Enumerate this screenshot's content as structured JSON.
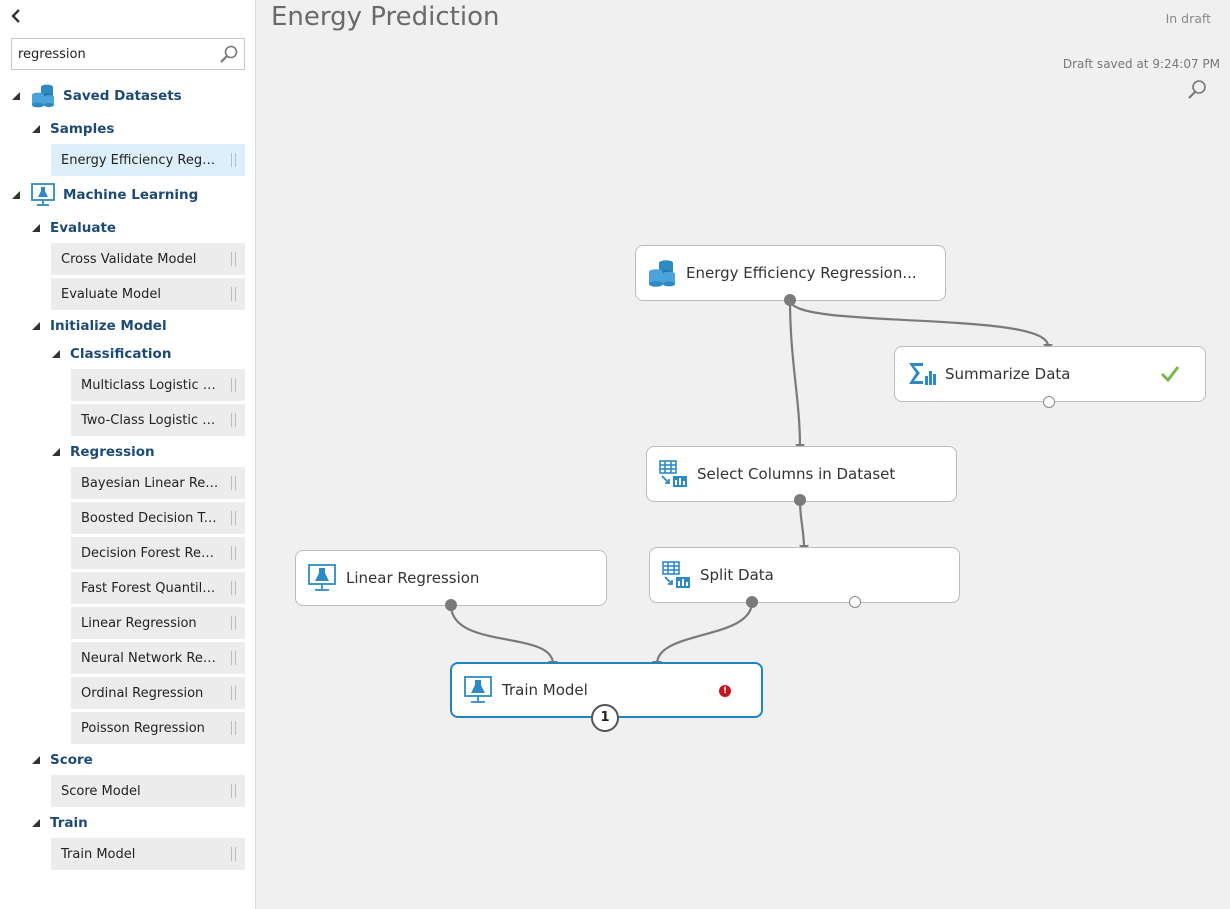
{
  "sidebar": {
    "search": {
      "value": "regression",
      "icon": "search-icon"
    },
    "groups": [
      {
        "label": "Saved Datasets",
        "icon": "dataset-icon"
      },
      {
        "label": "Machine Learning",
        "icon": "flask-monitor-icon"
      }
    ],
    "sub": {
      "samples": "Samples",
      "evaluate": "Evaluate",
      "initialize_model": "Initialize Model",
      "classification": "Classification",
      "regression": "Regression",
      "score": "Score",
      "train": "Train"
    },
    "items": {
      "energy": "Energy Efficiency Regression data",
      "cross_validate": "Cross Validate Model",
      "evaluate_model": "Evaluate Model",
      "multiclass_lr": "Multiclass Logistic Regression",
      "twoclass_lr": "Two-Class Logistic Regression",
      "bayesian": "Bayesian Linear Regression",
      "boosted": "Boosted Decision Tree Regression",
      "decision_forest": "Decision Forest Regression",
      "fast_forest": "Fast Forest Quantile Regression",
      "linear": "Linear Regression",
      "neural": "Neural Network Regression",
      "ordinal": "Ordinal Regression",
      "poisson": "Poisson Regression",
      "score_model": "Score Model",
      "train_model": "Train Model"
    }
  },
  "canvas": {
    "title": "Energy Prediction",
    "status": "In draft",
    "saved": "Draft saved at 9:24:07 PM",
    "modules": {
      "energy": "Energy Efficiency Regression...",
      "summarize": "Summarize Data",
      "select": "Select Columns in Dataset",
      "split": "Split Data",
      "linear": "Linear Regression",
      "train": "Train Model"
    },
    "train_error_badge": "1",
    "train_error_icon": "!",
    "colors": {
      "accent": "#1f84c2",
      "heading": "#1e4b76",
      "success": "#7ab648",
      "error": "#c8141c"
    }
  }
}
